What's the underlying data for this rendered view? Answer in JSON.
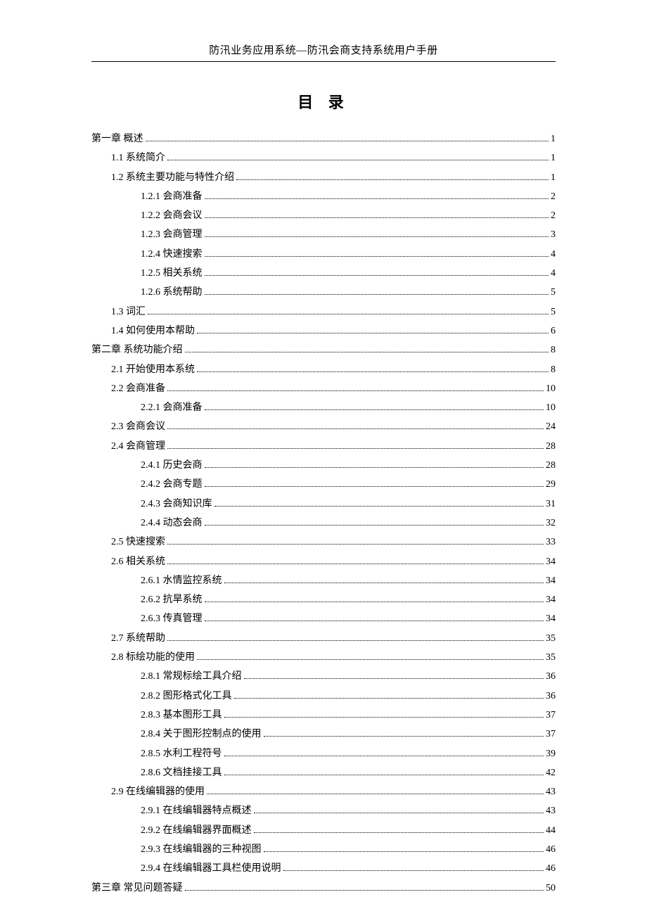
{
  "header_title": "防汛业务应用系统—防汛会商支持系统用户手册",
  "toc_title": "目 录",
  "entries": [
    {
      "level": 0,
      "label": "第一章  概述",
      "page": "1"
    },
    {
      "level": 1,
      "label": "1.1  系统简介",
      "page": "1"
    },
    {
      "level": 1,
      "label": "1.2  系统主要功能与特性介绍",
      "page": "1"
    },
    {
      "level": 2,
      "label": "1.2.1  会商准备",
      "page": "2"
    },
    {
      "level": 2,
      "label": "1.2.2  会商会议",
      "page": "2"
    },
    {
      "level": 2,
      "label": "1.2.3  会商管理",
      "page": "3"
    },
    {
      "level": 2,
      "label": "1.2.4  快速搜索",
      "page": "4"
    },
    {
      "level": 2,
      "label": "1.2.5  相关系统",
      "page": "4"
    },
    {
      "level": 2,
      "label": "1.2.6  系统帮助",
      "page": "5"
    },
    {
      "level": 1,
      "label": "1.3  词汇",
      "page": "5"
    },
    {
      "level": 1,
      "label": "1.4  如何使用本帮助",
      "page": "6"
    },
    {
      "level": 0,
      "label": "第二章  系统功能介绍",
      "page": "8"
    },
    {
      "level": 1,
      "label": "2.1  开始使用本系统",
      "page": "8"
    },
    {
      "level": 1,
      "label": "2.2  会商准备",
      "page": "10"
    },
    {
      "level": 2,
      "label": "2.2.1  会商准备",
      "page": "10"
    },
    {
      "level": 1,
      "label": "2.3  会商会议",
      "page": "24"
    },
    {
      "level": 1,
      "label": "2.4  会商管理",
      "page": "28"
    },
    {
      "level": 2,
      "label": "2.4.1  历史会商",
      "page": "28"
    },
    {
      "level": 2,
      "label": "2.4.2  会商专题",
      "page": "29"
    },
    {
      "level": 2,
      "label": "2.4.3  会商知识库",
      "page": "31"
    },
    {
      "level": 2,
      "label": "2.4.4  动态会商",
      "page": "32"
    },
    {
      "level": 1,
      "label": "2.5  快速搜索",
      "page": "33"
    },
    {
      "level": 1,
      "label": "2.6  相关系统",
      "page": "34"
    },
    {
      "level": 2,
      "label": "2.6.1  水情监控系统",
      "page": "34"
    },
    {
      "level": 2,
      "label": "2.6.2  抗旱系统",
      "page": "34"
    },
    {
      "level": 2,
      "label": "2.6.3  传真管理",
      "page": "34"
    },
    {
      "level": 1,
      "label": "2.7  系统帮助",
      "page": "35"
    },
    {
      "level": 1,
      "label": "2.8  标绘功能的使用",
      "page": "35"
    },
    {
      "level": 2,
      "label": "2.8.1  常规标绘工具介绍",
      "page": "36"
    },
    {
      "level": 2,
      "label": "2.8.2  图形格式化工具",
      "page": "36"
    },
    {
      "level": 2,
      "label": "2.8.3  基本图形工具",
      "page": "37"
    },
    {
      "level": 2,
      "label": "2.8.4  关于图形控制点的使用",
      "page": "37"
    },
    {
      "level": 2,
      "label": "2.8.5  水利工程符号",
      "page": "39"
    },
    {
      "level": 2,
      "label": "2.8.6  文档挂接工具",
      "page": "42"
    },
    {
      "level": 1,
      "label": "2.9  在线编辑器的使用",
      "page": "43"
    },
    {
      "level": 2,
      "label": "2.9.1  在线编辑器特点概述",
      "page": "43"
    },
    {
      "level": 2,
      "label": "2.9.2  在线编辑器界面概述",
      "page": "44"
    },
    {
      "level": 2,
      "label": "2.9.3  在线编辑器的三种视图",
      "page": "46"
    },
    {
      "level": 2,
      "label": "2.9.4  在线编辑器工具栏使用说明",
      "page": "46"
    },
    {
      "level": 0,
      "label": "第三章  常见问题答疑",
      "page": "50"
    }
  ]
}
